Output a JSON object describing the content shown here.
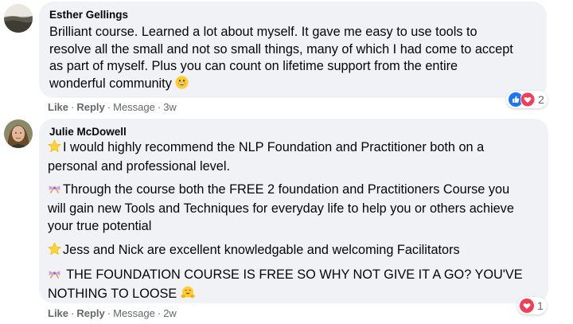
{
  "comments": [
    {
      "author": "Esther Gellings",
      "avatar_icon": "landscape-avatar-icon",
      "lines": [
        "Brilliant course. Learned a lot about myself. It gave me easy to use tools to",
        "resolve all the small and not so small things, many of which I had come to accept",
        "as part of myself. Plus you can count on lifetime support from the entire",
        "wonderful community"
      ],
      "end_emoji": "grinning-face-emoji",
      "actions": {
        "like": "Like",
        "reply": "Reply",
        "message": "Message",
        "time": "3w"
      },
      "reactions": {
        "icons": [
          "like-reaction-icon",
          "love-reaction-icon"
        ],
        "count": "2"
      }
    },
    {
      "author": "Julie McDowell",
      "avatar_icon": "person-avatar-icon",
      "paragraphs": [
        {
          "emoji": "glowing-star-emoji",
          "lines": [
            "I would highly recommend the NLP Foundation and Practitioner both on a",
            "personal and professional level."
          ]
        },
        {
          "emoji": "ribbon-emoji",
          "lines": [
            "Through the course both the FREE 2 foundation and Practitioners Course you",
            "will gain new Tools and Techniques for everyday life to help you or others achieve",
            "your true potential"
          ]
        },
        {
          "emoji": "glowing-star-emoji",
          "lines": [
            "Jess and Nick are excellent knowledgable and welcoming Facilitators"
          ]
        },
        {
          "emoji": "ribbon-emoji",
          "lines": [
            " THE FOUNDATION COURSE IS FREE SO WHY NOT GIVE IT A GO? YOU'VE",
            "NOTHING TO LOOSE"
          ]
        }
      ],
      "end_emoji": "smiling-face-with-open-hands-emoji",
      "actions": {
        "like": "Like",
        "reply": "Reply",
        "message": "Message",
        "time": "2w"
      },
      "reactions": {
        "icons": [
          "love-reaction-icon"
        ],
        "count": "1"
      }
    }
  ],
  "colors": {
    "bubble": "#f0f2f5",
    "meta_text": "#65676b",
    "like_blue": "#1877f2",
    "love_red": "#f33e58"
  }
}
